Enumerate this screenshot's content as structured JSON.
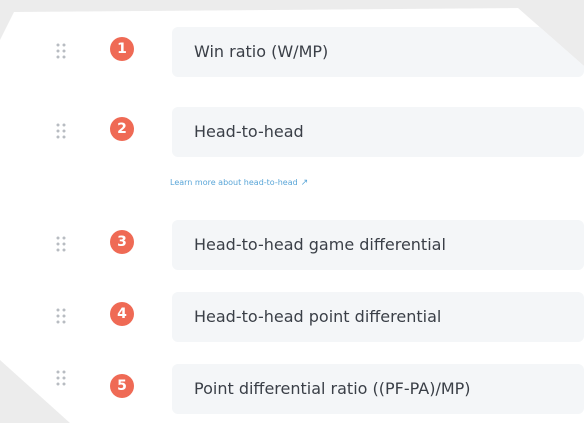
{
  "criteria": [
    {
      "number": "1",
      "label": "Win ratio (W/MP)"
    },
    {
      "number": "2",
      "label": "Head-to-head"
    },
    {
      "number": "3",
      "label": "Head-to-head game differential"
    },
    {
      "number": "4",
      "label": "Head-to-head point differential"
    },
    {
      "number": "5",
      "label": "Point differential ratio ((PF-PA)/MP)"
    }
  ],
  "learn_link": {
    "text": "Learn more about head-to-head",
    "icon": "external-link-icon"
  },
  "colors": {
    "badge": "#ef6a55",
    "field_background": "#f4f6f8",
    "label_text": "#3a3f47",
    "link": "#5aa6d8"
  },
  "icons": {
    "drag_handle": "drag-handle-icon"
  }
}
